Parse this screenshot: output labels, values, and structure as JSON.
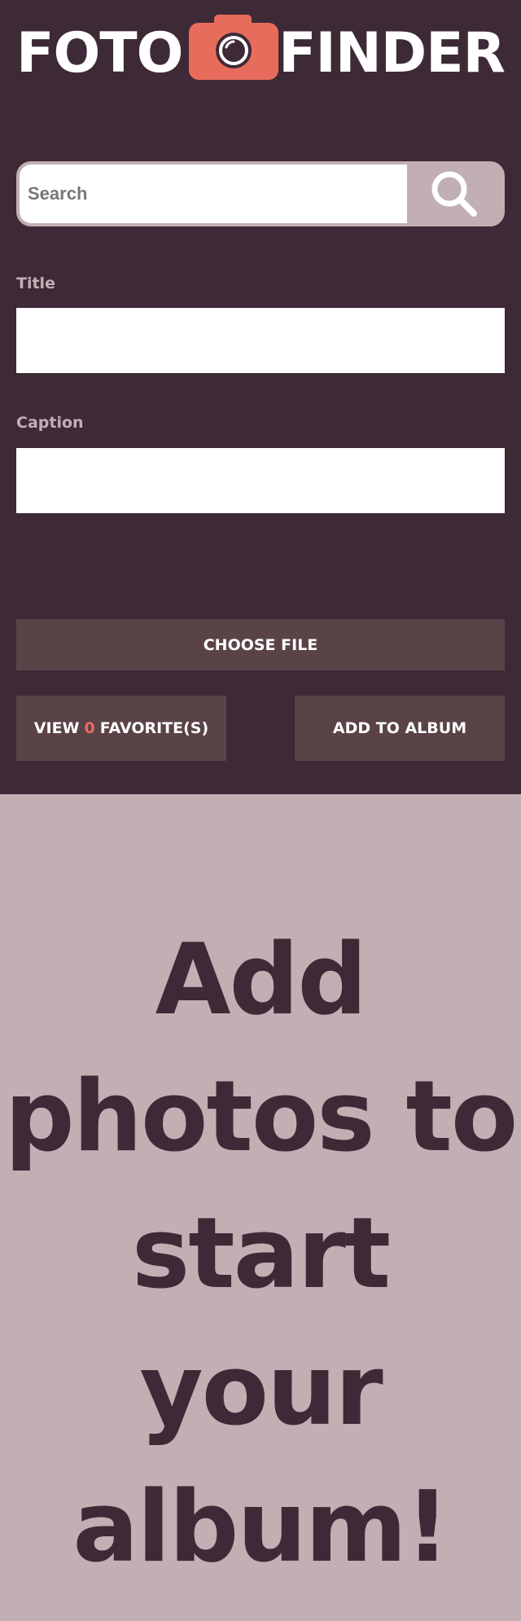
{
  "app": {
    "title_left": "FOTO",
    "title_right": "FINDER",
    "logo_icon": "camera-icon"
  },
  "search": {
    "placeholder": "Search",
    "value": "",
    "button_icon": "search-icon"
  },
  "form": {
    "title_label": "Title",
    "title_value": "",
    "caption_label": "Caption",
    "caption_value": ""
  },
  "actions": {
    "choose_file_label": "CHOOSE FILE",
    "view_label": "VIEW",
    "favorites_count": "0",
    "favorites_label": "FAVORITE(S)",
    "add_album_label": "ADD TO ALBUM"
  },
  "empty_state": {
    "message": "Add photos to start your album!"
  },
  "colors": {
    "header_bg": "#3e2a36",
    "body_bg": "#c2afb4",
    "button_bg": "#5a4347",
    "accent": "#e76c5c",
    "text_light": "#ffffff"
  }
}
